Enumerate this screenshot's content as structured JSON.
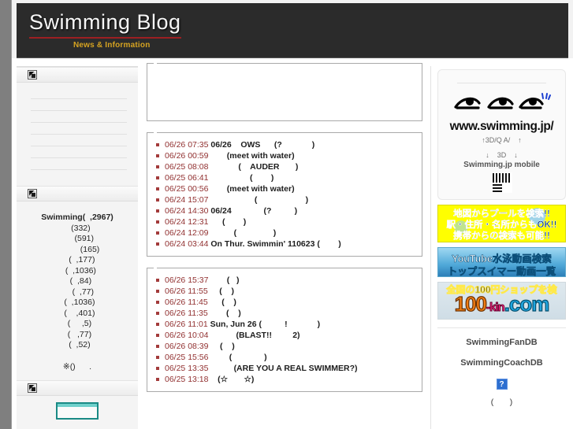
{
  "site": {
    "title": "Swimming Blog",
    "subtitle": "News & Information"
  },
  "colors": {
    "header_bg": "#2b2b2b",
    "title_underline": "#9c1f22",
    "subtitle": "#d6a321",
    "entry_time": "#913030",
    "bullet": "#a33b3b",
    "page_bg": "#7f7f7f"
  },
  "left_sidebar": {
    "widget1": {
      "icon": "broken-image-icon",
      "blank_rows": 7
    },
    "widget2": {
      "icon": "broken-image-icon",
      "rows": [
        "Swimming(  ,2967)",
        "   (332)",
        "      (591)",
        "           (165)",
        "    (  ,177)",
        "   (  ,1036)",
        "   (  ,84)",
        "     (  ,77)",
        "  (  ,1036)",
        "  (    ,401)",
        "  (     ,5)",
        "  (   ,77)",
        "  (  ,52)"
      ],
      "note": "※()      ."
    },
    "widget3": {
      "icon": "broken-image-icon",
      "badge_left": "",
      "badge_right": ""
    }
  },
  "main": {
    "box_empty": {
      "legend": ""
    },
    "list1": {
      "legend": "",
      "entries": [
        {
          "time": "06/26 07:35",
          "title": "06/26",
          "text": "    OWS      (?             )"
        },
        {
          "time": "06/26 00:59",
          "title": "",
          "text": "       (meet with water)"
        },
        {
          "time": "06/25 08:08",
          "title": "",
          "text": "            (    AUDER       )"
        },
        {
          "time": "06/25 06:41",
          "title": "",
          "text": "                 (        )"
        },
        {
          "time": "06/25 00:56",
          "title": "",
          "text": "       (meet with water)"
        },
        {
          "time": "06/24 15:07",
          "title": "",
          "text": "                   (                     )"
        },
        {
          "time": "06/24 14:30",
          "title": "06/24",
          "text": "              (?          )"
        },
        {
          "time": "06/24 12:31",
          "title": "",
          "text": "     (        )"
        },
        {
          "time": "06/24 12:09",
          "title": "",
          "text": "          (                )"
        },
        {
          "time": "06/24 03:44",
          "title": "On Thur. Swimmin' 110623",
          "text": " (        )"
        }
      ]
    },
    "list2": {
      "legend": "",
      "entries": [
        {
          "time": "06/26 15:37",
          "title": "",
          "text": "       (   )"
        },
        {
          "time": "06/26 11:55",
          "title": "",
          "text": "    (    )"
        },
        {
          "time": "06/26 11:45",
          "title": "",
          "text": "     (    )"
        },
        {
          "time": "06/26 11:35",
          "title": "",
          "text": "       (    )"
        },
        {
          "time": "06/26 11:01",
          "title": "Sun, Jun 26",
          "text": " (          !             )"
        },
        {
          "time": "06/26 10:04",
          "title": "",
          "text": "           (BLAST!!         2)"
        },
        {
          "time": "06/26 08:39",
          "title": "",
          "text": "    (    )"
        },
        {
          "time": "06/25 15:56",
          "title": "",
          "text": "        (              )"
        },
        {
          "time": "06/25 13:35",
          "title": "",
          "text": "          (ARE YOU A REAL SWIMMER?)"
        },
        {
          "time": "06/25 13:18",
          "title": "",
          "text": "   (☆       ☆)"
        }
      ]
    }
  },
  "right_sidebar": {
    "logo": {
      "icon": "swimmer-logo-icon",
      "url_text": "www.swimming.jp/",
      "caption1": "↑3D/Q A/    ↑",
      "caption2": "↓    3D    ↓",
      "mobile_label": "Swimming.jp mobile",
      "qr": "qr-code-icon"
    },
    "banners": [
      {
        "name": "pool-map-search-banner",
        "lines": [
          "地図からプールを検索!!",
          "駅・住所・名所からもOK!!",
          "携帯からの検索も可能!!"
        ]
      },
      {
        "name": "youtube-swim-video-banner",
        "lines": [
          "YouTube水泳動画検索",
          "トップスイマー動画一覧"
        ]
      },
      {
        "name": "hyakkin-shop-banner",
        "lines": [
          "全国の100円ショップを検",
          "100",
          "-kin",
          ".com"
        ]
      }
    ],
    "links": [
      {
        "label": "SwimmingFanDB"
      },
      {
        "label": "SwimmingCoachDB"
      }
    ],
    "broken_icon": "?",
    "paren_text": "(       )"
  }
}
